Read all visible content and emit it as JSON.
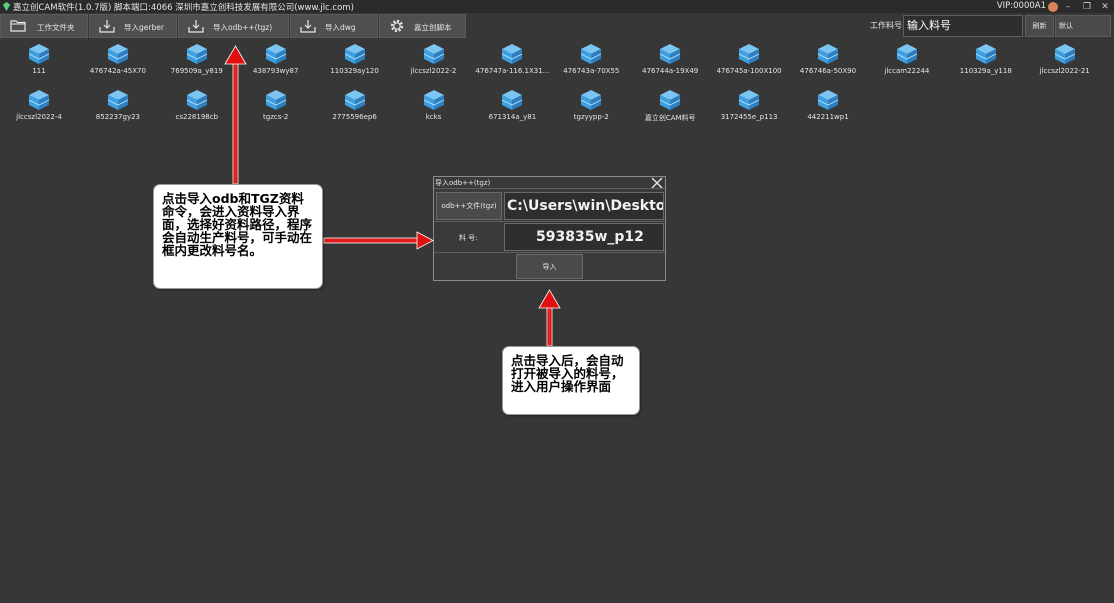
{
  "window": {
    "title": "嘉立创CAM软件(1.0.7版) 脚本端口:4066 深圳市嘉立创科技发展有限公司(www.jlc.com)",
    "vip": "VIP:0000A1"
  },
  "toolbar": {
    "buttons": [
      {
        "label": "工作文件夹",
        "icon": "folder-icon"
      },
      {
        "label": "导入gerber",
        "icon": "import-tray-icon"
      },
      {
        "label": "导入odb++(tgz)",
        "icon": "import-tray-icon"
      },
      {
        "label": "导入dwg",
        "icon": "import-tray-icon"
      },
      {
        "label": "嘉立创脚本",
        "icon": "gear-icon"
      }
    ],
    "part_label": "工作料号:",
    "part_value": "输入料号",
    "refresh_label": "刷新",
    "default_label": "默认"
  },
  "files": [
    "111",
    "476742a-45X70",
    "769509a_y819",
    "438793wy87",
    "110329ay120",
    "jlccszl2022-2",
    "476747a-116.1X31...",
    "476743a-70X55",
    "476744a-19X49",
    "476745a-100X100",
    "476746a-50X90",
    "jlccam22244",
    "110329a_y118",
    "jlccszl2022-21",
    "jlccszl2022-4",
    "852237gy23",
    "cs228198cb",
    "tgzcs-2",
    "2775596ep6",
    "kcks",
    "671314a_y81",
    "tgzyypp-2",
    "嘉立创CAM料号",
    "3172455e_p113",
    "442211wp1"
  ],
  "dialog": {
    "title": "导入odb++(tgz)",
    "file_button": "odb++文件(tgz)",
    "file_path": "C:\\Users\\win\\Desktop\\",
    "part_label": "料 号:",
    "part_value": "593835w_p12",
    "import_button": "导入"
  },
  "callouts": {
    "left": "点击导入odb和TGZ资料命令，会进入资料导入界面，选择好资料路径，程序会自动生产料号，可手动在框内更改料号名。",
    "bottom": "点击导入后，会自动打开被导入的料号，进入用户操作界面"
  },
  "colors": {
    "background": "#373737",
    "arrow": "#ff1e1e",
    "cube": "#3ea0e0"
  }
}
